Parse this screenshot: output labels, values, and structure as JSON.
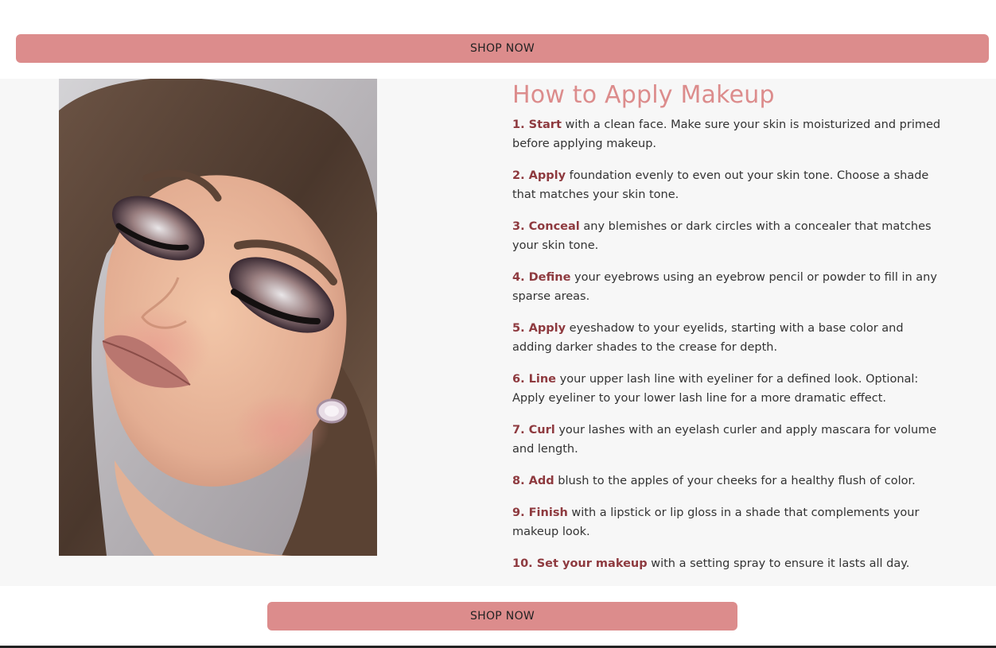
{
  "shop_now_top": "SHOP NOW",
  "shop_now_bottom": "SHOP NOW",
  "title": "How to Apply Makeup",
  "steps": [
    {
      "lead": "1. Start",
      "text": " with a clean face. Make sure your skin is moisturized and primed before applying makeup."
    },
    {
      "lead": "2. Apply",
      "text": " foundation evenly to even out your skin tone. Choose a shade that matches your skin tone."
    },
    {
      "lead": "3. Conceal",
      "text": " any blemishes or dark circles with a concealer that matches your skin tone."
    },
    {
      "lead": "4. Define",
      "text": " your eyebrows using an eyebrow pencil or powder to fill in any sparse areas."
    },
    {
      "lead": "5. Apply",
      "text": " eyeshadow to your eyelids, starting with a base color and adding darker shades to the crease for depth."
    },
    {
      "lead": "6. Line",
      "text": " your upper lash line with eyeliner for a defined look. Optional: Apply eyeliner to your lower lash line for a more dramatic effect."
    },
    {
      "lead": "7. Curl",
      "text": " your lashes with an eyelash curler and apply mascara for volume and length."
    },
    {
      "lead": "8. Add",
      "text": " blush to the apples of your cheeks for a healthy flush of color."
    },
    {
      "lead": "9. Finish",
      "text": " with a lipstick or lip gloss in a shade that complements your makeup look."
    },
    {
      "lead": "10. Set your makeup",
      "text": " with a setting spray to ensure it lasts all day."
    }
  ],
  "colors": {
    "accent": "#dc8c8c",
    "step_lead": "#8e3a3f",
    "body_text": "#333333",
    "band_bg": "#f7f7f7"
  }
}
